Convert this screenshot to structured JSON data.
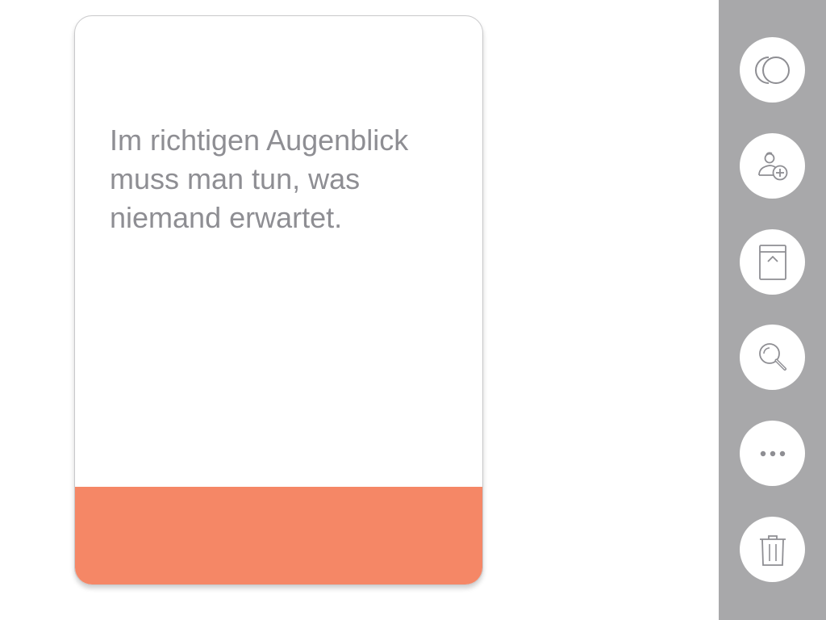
{
  "card": {
    "quote": "Im richtigen Augenblick muss man tun, was niemand erwartet.",
    "accent_color": "#f58766",
    "text_color": "#8e8e93"
  },
  "toolbar": {
    "background": "#a8a8aa",
    "buttons": [
      {
        "icon": "overlapping-circles-icon"
      },
      {
        "icon": "add-person-icon"
      },
      {
        "icon": "archive-box-icon"
      },
      {
        "icon": "search-icon"
      },
      {
        "icon": "more-options-icon"
      },
      {
        "icon": "trash-icon"
      }
    ]
  }
}
